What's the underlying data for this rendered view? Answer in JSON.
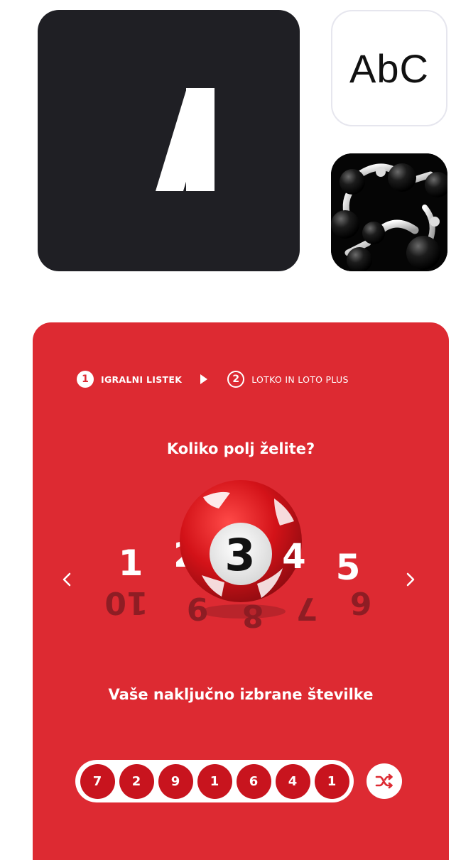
{
  "tiles": {
    "logo_icon": "slash-logo-icon",
    "abc_label": "AbC",
    "molecule_icon": "molecule-image"
  },
  "steps": [
    {
      "number": "1",
      "label": "IGRALNI LISTEK",
      "active": true
    },
    {
      "number": "2",
      "label": "LOTKO IN LOTO PLUS",
      "active": false
    }
  ],
  "question": "Koliko polj želite?",
  "selector": {
    "selected": "3",
    "front_numbers": [
      "1",
      "2",
      "3",
      "4",
      "5"
    ],
    "back_numbers": [
      "10",
      "9",
      "8",
      "7",
      "6"
    ]
  },
  "subhead": "Vaše naključno izbrane številke",
  "random_numbers": [
    "7",
    "2",
    "9",
    "1",
    "6",
    "4",
    "1"
  ],
  "colors": {
    "card_bg": "#dd2a32",
    "pick_bg": "#c8141e",
    "back_number": "#8e1d24",
    "logo_bg": "#1f1f24"
  }
}
